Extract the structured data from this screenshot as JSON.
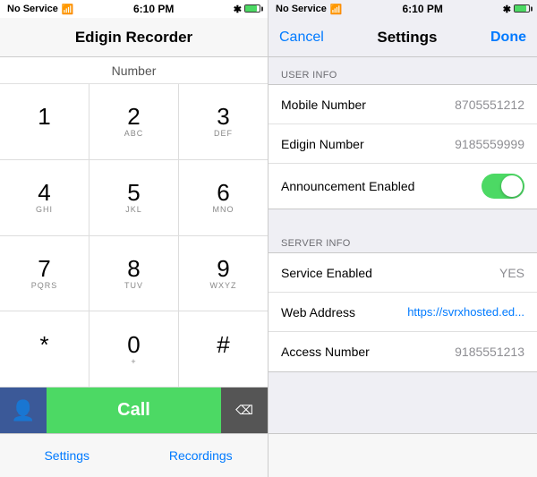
{
  "left": {
    "status": {
      "left_text": "No Service",
      "time": "6:10 PM",
      "bluetooth": "✱"
    },
    "app_title": "Edigin Recorder",
    "number_label": "Number",
    "keys": [
      [
        {
          "digit": "1",
          "letters": ""
        },
        {
          "digit": "2",
          "letters": "ABC"
        },
        {
          "digit": "3",
          "letters": "DEF"
        }
      ],
      [
        {
          "digit": "4",
          "letters": "GHI"
        },
        {
          "digit": "5",
          "letters": "JKL"
        },
        {
          "digit": "6",
          "letters": "MNO"
        }
      ],
      [
        {
          "digit": "7",
          "letters": "PQRS"
        },
        {
          "digit": "8",
          "letters": "TUV"
        },
        {
          "digit": "9",
          "letters": "WXYZ"
        }
      ],
      [
        {
          "digit": "*",
          "letters": ""
        },
        {
          "digit": "0",
          "letters": "+"
        },
        {
          "digit": "#",
          "letters": ""
        }
      ]
    ],
    "call_label": "Call",
    "tabs": [
      {
        "label": "Settings"
      },
      {
        "label": "Recordings"
      }
    ]
  },
  "right": {
    "status": {
      "left_text": "No Service",
      "time": "6:10 PM",
      "bluetooth": "✱"
    },
    "header": {
      "cancel": "Cancel",
      "title": "Settings",
      "done": "Done"
    },
    "sections": [
      {
        "title": "USER INFO",
        "rows": [
          {
            "label": "Mobile Number",
            "value": "8705551212",
            "type": "text"
          },
          {
            "label": "Edigin Number",
            "value": "9185559999",
            "type": "text"
          },
          {
            "label": "Announcement Enabled",
            "value": "",
            "type": "toggle"
          }
        ]
      },
      {
        "title": "SERVER INFO",
        "rows": [
          {
            "label": "Service Enabled",
            "value": "YES",
            "type": "text"
          },
          {
            "label": "Web Address",
            "value": "https://svrxhosted.ed...",
            "type": "blue"
          },
          {
            "label": "Access Number",
            "value": "9185551213",
            "type": "text"
          }
        ]
      }
    ]
  }
}
